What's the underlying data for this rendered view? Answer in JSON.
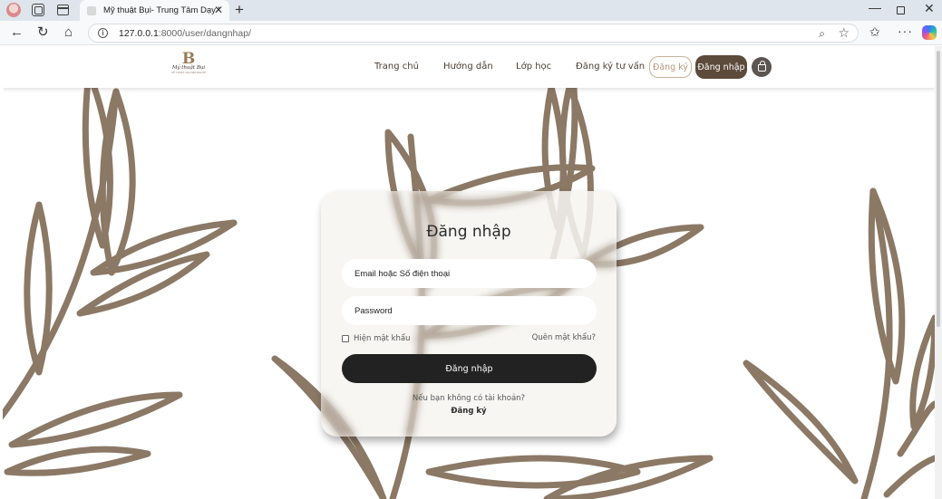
{
  "browser": {
    "tab_title": "Mỹ thuật Bụi- Trung Tâm Dạy Vẽ Đ",
    "url_host": "127.0.0.1",
    "url_path": ":8000/user/dangnhap/"
  },
  "header": {
    "logo_letter": "B",
    "logo_name": "Mỹ thuật Bụi",
    "logo_tagline": "MỸ THUẬT CHO MỌI NGƯỜI",
    "nav": [
      "Trang chủ",
      "Hướng dẫn",
      "Lớp học",
      "Đăng ký tư vấn"
    ],
    "register_label": "Đăng ký",
    "login_label": "Đăng nhập"
  },
  "login": {
    "title": "Đăng nhập",
    "email_placeholder": "Email hoặc Số điện thoại",
    "password_placeholder": "Password",
    "show_password": "Hiện mật khẩu",
    "forgot_password": "Quên mật khẩu?",
    "submit_label": "Đăng nhập",
    "no_account": "Nếu bạn không có tài khoản?",
    "register_link": "Đăng ký"
  },
  "colors": {
    "brand_brown": "#5c4a3a",
    "leaf": "#8b7865",
    "button_dark": "#222222"
  }
}
